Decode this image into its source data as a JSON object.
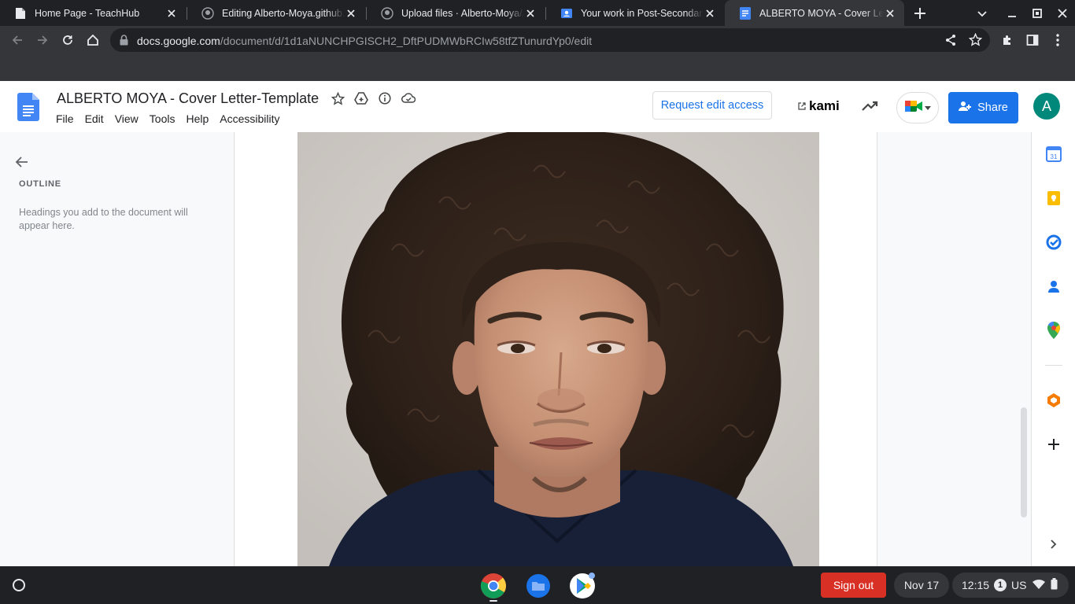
{
  "browser": {
    "tabs": [
      {
        "title": "Home Page - TeachHub",
        "icon": "doc-page-icon",
        "active": false
      },
      {
        "title": "Editing Alberto-Moya.github.io",
        "icon": "github-icon",
        "active": false
      },
      {
        "title": "Upload files · Alberto-Moya/Alberto-Moya.github.io",
        "icon": "github-icon",
        "active": false
      },
      {
        "title": "Your work in Post-Secondary Planning",
        "icon": "classroom-icon",
        "active": false
      },
      {
        "title": "ALBERTO MOYA - Cover Letter-Template",
        "icon": "docs-icon",
        "active": true
      }
    ],
    "url_host": "docs.google.com",
    "url_path": "/document/d/1d1aNUNCHPGISCH2_DftPUDMWbRCIw58tfZTunurdYp0/edit"
  },
  "docs": {
    "title": "ALBERTO MOYA - Cover Letter-Template",
    "menu": [
      "File",
      "Edit",
      "View",
      "Tools",
      "Help",
      "Accessibility"
    ],
    "request_edit_label": "Request edit access",
    "kami_label": "kami",
    "share_label": "Share",
    "avatar_letter": "A",
    "accent": "#1a73e8"
  },
  "outline": {
    "title": "OUTLINE",
    "hint": "Headings you add to the document will appear here."
  },
  "side_panel": [
    "calendar-icon",
    "keep-icon",
    "tasks-icon",
    "contacts-icon",
    "maps-icon",
    "office-icon",
    "add-icon",
    "expand-icon"
  ],
  "shelf": {
    "apps": [
      "chrome-icon",
      "files-icon",
      "play-store-icon"
    ],
    "signout_label": "Sign out",
    "date": "Nov 17",
    "time": "12:15",
    "notification_count": "1",
    "keyboard_layout": "US",
    "signout_color": "#d93025"
  }
}
